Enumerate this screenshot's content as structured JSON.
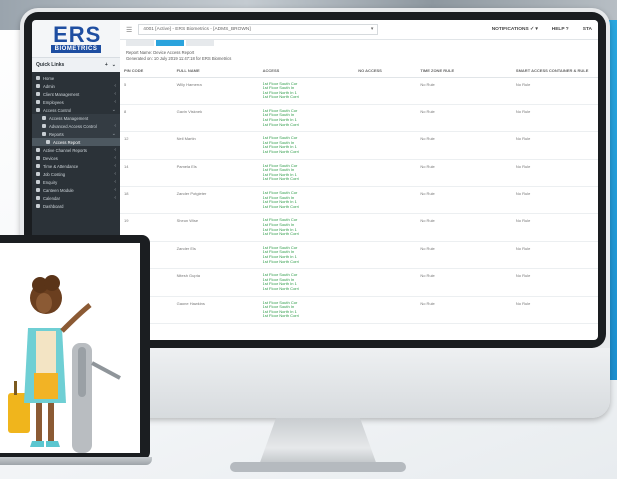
{
  "app": {
    "logo_text": "ERS",
    "logo_subtext": "BIOMETRICS",
    "tenant_selector": "4001 [Active] - ERS Biometrics - [ADMS_BROWN]",
    "notifications_label": "NOTIFICATIONS",
    "help_label": "HELP ?",
    "status_label": "STA"
  },
  "sidebar": {
    "quick_links_title": "Quick Links",
    "quick_links_add": "+",
    "quick_links_toggle": "⌄",
    "items": [
      {
        "label": "Home",
        "chevron": ""
      },
      {
        "label": "Admin",
        "chevron": "‹"
      },
      {
        "label": "Client Management",
        "chevron": "‹"
      },
      {
        "label": "Employees",
        "chevron": "‹"
      },
      {
        "label": "Access Control",
        "chevron": "⌄"
      },
      {
        "label": "Access Management",
        "chevron": ""
      },
      {
        "label": "Advanced Access Control",
        "chevron": "‹"
      },
      {
        "label": "Reports",
        "chevron": "⌄"
      },
      {
        "label": "Access Report",
        "chevron": ""
      },
      {
        "label": "Active Channel Reports",
        "chevron": "‹"
      },
      {
        "label": "Devices",
        "chevron": "‹"
      },
      {
        "label": "Time & Attendance",
        "chevron": "‹"
      },
      {
        "label": "Job Costing",
        "chevron": "‹"
      },
      {
        "label": "Enquiry",
        "chevron": "‹"
      },
      {
        "label": "Canteen Module",
        "chevron": "‹"
      },
      {
        "label": "Calendar",
        "chevron": "‹"
      },
      {
        "label": "Dashboard",
        "chevron": ""
      }
    ]
  },
  "report": {
    "name_line": "Report Name: Device Access Report",
    "generated_line": "Generated on: 10 July 2019 11:47:18 for ERS Biometrics",
    "columns": [
      "PIN CODE",
      "FULL NAME",
      "ACCESS",
      "NO ACCESS",
      "TIME ZONE RULE",
      "SMART ACCESS CONTAINER & RULE"
    ],
    "access_lines": [
      "1st Floor South Cor",
      "1st Floor South In",
      "1st Floor North In 1",
      "1st Floor North Corri"
    ],
    "rows": [
      {
        "pin": "5",
        "name": "Willy Hamerra",
        "no_access": "",
        "tz": "No Rule",
        "smart": "No Rule"
      },
      {
        "pin": "8",
        "name": "Gavin Visknek",
        "no_access": "",
        "tz": "No Rule",
        "smart": "No Rule"
      },
      {
        "pin": "12",
        "name": "Neil Martin",
        "no_access": "",
        "tz": "No Rule",
        "smart": "No Rule"
      },
      {
        "pin": "14",
        "name": "Pamela Els",
        "no_access": "",
        "tz": "No Rule",
        "smart": "No Rule"
      },
      {
        "pin": "18",
        "name": "Zander Potgieter",
        "no_access": "",
        "tz": "No Rule",
        "smart": "No Rule"
      },
      {
        "pin": "19",
        "name": "Sheun Wise",
        "no_access": "",
        "tz": "No Rule",
        "smart": "No Rule"
      },
      {
        "pin": "",
        "name": "Zander Els",
        "no_access": "",
        "tz": "No Rule",
        "smart": "No Rule"
      },
      {
        "pin": "",
        "name": "Nitesh Gupta",
        "no_access": "",
        "tz": "No Rule",
        "smart": "No Rule"
      },
      {
        "pin": "",
        "name": "Gaone Hawkins",
        "no_access": "",
        "tz": "No Rule",
        "smart": "No Rule"
      }
    ]
  },
  "colors": {
    "brand_blue": "#1e4ea1",
    "accent_blue": "#2aa3dd",
    "access_green": "#2a9a45",
    "sidebar_dark": "#2b3238"
  }
}
